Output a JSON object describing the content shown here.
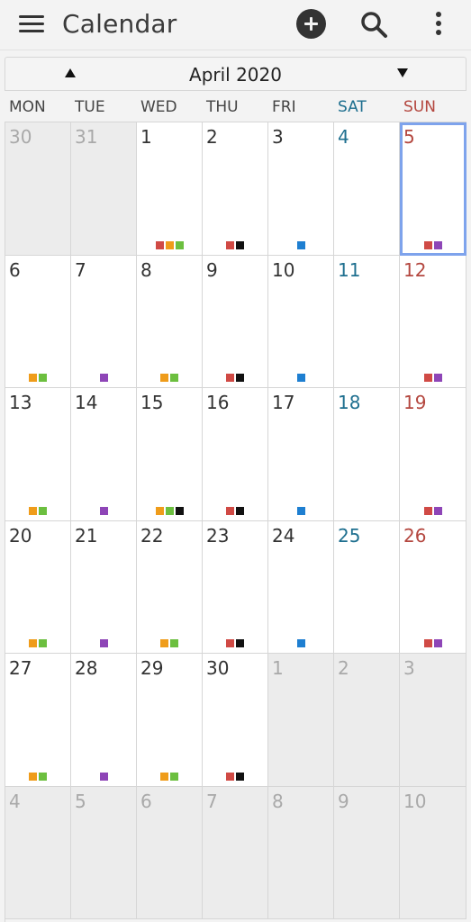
{
  "appbar": {
    "title": "Calendar",
    "icons": {
      "menu": "hamburger-menu-icon",
      "add": "add-circle-icon",
      "search": "search-icon",
      "more": "more-vertical-icon"
    }
  },
  "month": {
    "label": "April 2020",
    "prev_icon": "triangle-up-icon",
    "next_icon": "triangle-down-icon"
  },
  "weekdays": [
    "MON",
    "TUE",
    "WED",
    "THU",
    "FRI",
    "SAT",
    "SUN"
  ],
  "colors": {
    "red": "#d04a45",
    "orange": "#ef9c1a",
    "green": "#6cbf3f",
    "black": "#111111",
    "blue": "#1e7fd1",
    "purple": "#8e45b7",
    "saturday": "#1e6f8f",
    "sunday": "#b4473f",
    "today_outline": "#7ea3ec"
  },
  "weeks": [
    [
      {
        "day": "30",
        "other": true,
        "events": []
      },
      {
        "day": "31",
        "other": true,
        "events": []
      },
      {
        "day": "1",
        "events": [
          "red",
          "orange",
          "green"
        ]
      },
      {
        "day": "2",
        "events": [
          "red",
          "black"
        ]
      },
      {
        "day": "3",
        "events": [
          "blue"
        ]
      },
      {
        "day": "4",
        "events": []
      },
      {
        "day": "5",
        "today": true,
        "events": [
          "red",
          "purple"
        ]
      }
    ],
    [
      {
        "day": "6",
        "events": [
          "orange",
          "green"
        ]
      },
      {
        "day": "7",
        "events": [
          "purple"
        ]
      },
      {
        "day": "8",
        "events": [
          "orange",
          "green"
        ]
      },
      {
        "day": "9",
        "events": [
          "red",
          "black"
        ]
      },
      {
        "day": "10",
        "events": [
          "blue"
        ]
      },
      {
        "day": "11",
        "events": []
      },
      {
        "day": "12",
        "events": [
          "red",
          "purple"
        ]
      }
    ],
    [
      {
        "day": "13",
        "events": [
          "orange",
          "green"
        ]
      },
      {
        "day": "14",
        "events": [
          "purple"
        ]
      },
      {
        "day": "15",
        "events": [
          "orange",
          "green",
          "black"
        ]
      },
      {
        "day": "16",
        "events": [
          "red",
          "black"
        ]
      },
      {
        "day": "17",
        "events": [
          "blue"
        ]
      },
      {
        "day": "18",
        "events": []
      },
      {
        "day": "19",
        "events": [
          "red",
          "purple"
        ]
      }
    ],
    [
      {
        "day": "20",
        "events": [
          "orange",
          "green"
        ]
      },
      {
        "day": "21",
        "events": [
          "purple"
        ]
      },
      {
        "day": "22",
        "events": [
          "orange",
          "green"
        ]
      },
      {
        "day": "23",
        "events": [
          "red",
          "black"
        ]
      },
      {
        "day": "24",
        "events": [
          "blue"
        ]
      },
      {
        "day": "25",
        "events": []
      },
      {
        "day": "26",
        "events": [
          "red",
          "purple"
        ]
      }
    ],
    [
      {
        "day": "27",
        "events": [
          "orange",
          "green"
        ]
      },
      {
        "day": "28",
        "events": [
          "purple"
        ]
      },
      {
        "day": "29",
        "events": [
          "orange",
          "green"
        ]
      },
      {
        "day": "30",
        "events": [
          "red",
          "black"
        ]
      },
      {
        "day": "1",
        "other": true,
        "events": []
      },
      {
        "day": "2",
        "other": true,
        "events": []
      },
      {
        "day": "3",
        "other": true,
        "events": []
      }
    ],
    [
      {
        "day": "4",
        "other": true,
        "events": []
      },
      {
        "day": "5",
        "other": true,
        "events": []
      },
      {
        "day": "6",
        "other": true,
        "events": []
      },
      {
        "day": "7",
        "other": true,
        "events": []
      },
      {
        "day": "8",
        "other": true,
        "events": []
      },
      {
        "day": "9",
        "other": true,
        "events": []
      },
      {
        "day": "10",
        "other": true,
        "events": []
      }
    ]
  ]
}
